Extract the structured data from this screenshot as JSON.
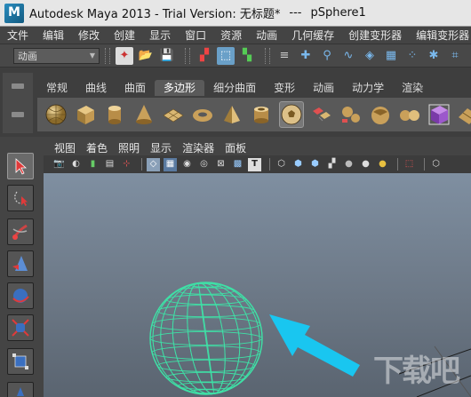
{
  "titlebar": {
    "app_name": "Autodesk Maya 2013 - Trial Version: 无标题*",
    "dashes": "---",
    "selection": "pSphere1"
  },
  "menubar": {
    "items": [
      "文件",
      "编辑",
      "修改",
      "创建",
      "显示",
      "窗口",
      "资源",
      "动画",
      "几何缓存",
      "创建变形器",
      "编辑变形器"
    ]
  },
  "statusline": {
    "menuset_value": "动画"
  },
  "shelf": {
    "tabs": [
      "常规",
      "曲线",
      "曲面",
      "多边形",
      "细分曲面",
      "变形",
      "动画",
      "动力学",
      "渲染"
    ],
    "active_tab": "多边形",
    "icons": [
      "poly-sphere-icon",
      "poly-cube-icon",
      "poly-cylinder-icon",
      "poly-cone-icon",
      "poly-plane-icon",
      "poly-torus-icon",
      "poly-pyramid-icon",
      "poly-pipe-icon",
      "poly-soccer-ball-icon",
      "combine-icon",
      "separate-icon",
      "extract-icon",
      "smooth-icon",
      "boolean-icon",
      "average-icon"
    ]
  },
  "panel": {
    "menus": [
      "视图",
      "着色",
      "照明",
      "显示",
      "渲染器",
      "面板"
    ]
  },
  "viewport": {
    "object": "sphere",
    "wireframe_color": "#3fe0a6",
    "arrow_color": "#19c6f0",
    "background_color": "#76848f"
  },
  "watermark": {
    "text": "下载吧"
  },
  "colors": {
    "ui_dark": "#444444",
    "titlebar": "#e6e6e6"
  }
}
